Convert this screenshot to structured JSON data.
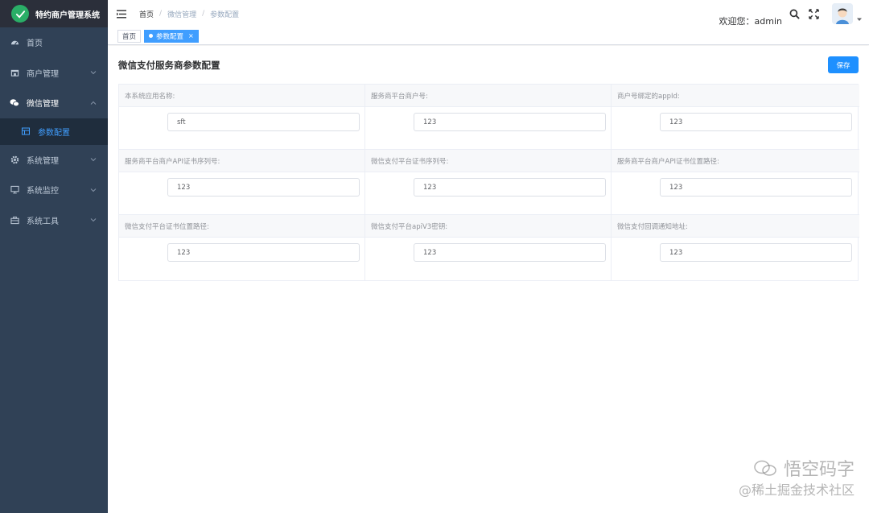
{
  "app": {
    "title": "特约商户管理系统"
  },
  "sidebar": {
    "items": [
      {
        "label": "首页",
        "icon": "dashboard-icon"
      },
      {
        "label": "商户管理",
        "icon": "shop-icon"
      },
      {
        "label": "微信管理",
        "icon": "wechat-icon",
        "expanded": true
      },
      {
        "label": "参数配置",
        "icon": "table-icon",
        "active": true,
        "submenu": true
      },
      {
        "label": "系统管理",
        "icon": "gear-icon"
      },
      {
        "label": "系统监控",
        "icon": "monitor-icon"
      },
      {
        "label": "系统工具",
        "icon": "toolbox-icon"
      }
    ]
  },
  "header": {
    "breadcrumb": [
      "首页",
      "微信管理",
      "参数配置"
    ],
    "welcome": "欢迎您：admin"
  },
  "tags": [
    {
      "label": "首页",
      "active": false
    },
    {
      "label": "参数配置",
      "active": true,
      "close": "×"
    }
  ],
  "main": {
    "title": "微信支付服务商参数配置",
    "save_label": "保存",
    "fields": [
      {
        "label": "本系统应用名称:",
        "value": "sft"
      },
      {
        "label": "服务商平台商户号:",
        "value": "123"
      },
      {
        "label": "商户号绑定的appId:",
        "value": "123"
      },
      {
        "label": "服务商平台商户API证书序列号:",
        "value": "123"
      },
      {
        "label": "微信支付平台证书序列号:",
        "value": "123"
      },
      {
        "label": "服务商平台商户API证书位置路径:",
        "value": "123"
      },
      {
        "label": "微信支付平台证书位置路径:",
        "value": "123"
      },
      {
        "label": "微信支付平台apiV3密钥:",
        "value": "123"
      },
      {
        "label": "微信支付回调通知地址:",
        "value": "123"
      }
    ]
  },
  "watermark": {
    "line1": "悟空码字",
    "line2": "@稀土掘金技术社区"
  },
  "colors": {
    "sidebar": "#304156",
    "accent": "#409eff",
    "save": "#1e90ff"
  }
}
